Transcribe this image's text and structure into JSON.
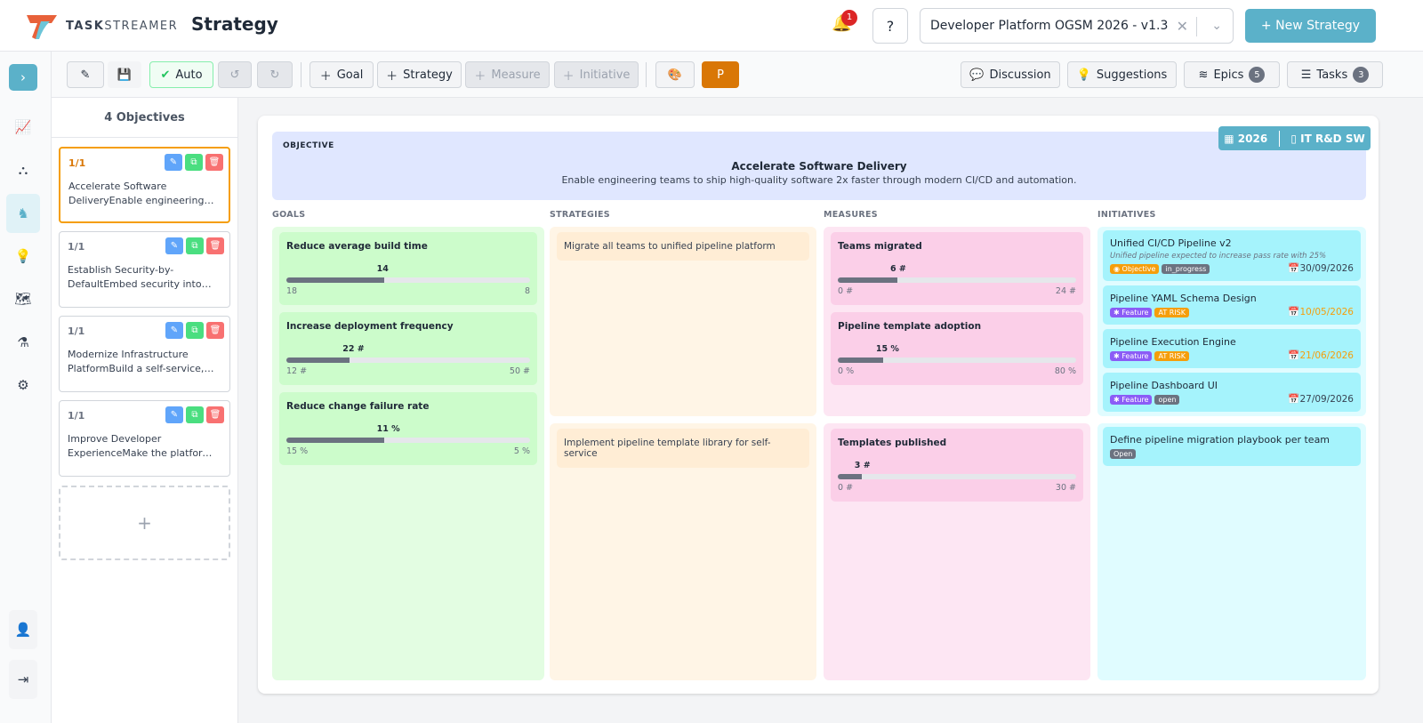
{
  "header": {
    "brand_a": "TASK",
    "brand_b": "STREAMER",
    "title": "Strategy",
    "notifications": "1",
    "strategy_select": "Developer Platform OGSM 2026 - v1.3",
    "new_strategy": "+ New Strategy"
  },
  "toolbar": {
    "auto": "Auto",
    "goal": "Goal",
    "strategy": "Strategy",
    "measure": "Measure",
    "initiative": "Initiative",
    "discussion": "Discussion",
    "suggestions": "Suggestions",
    "epics": "Epics",
    "epics_count": "5",
    "tasks": "Tasks",
    "tasks_count": "3"
  },
  "objectives_panel": {
    "heading": "4 Objectives",
    "items": [
      {
        "num": "1/1",
        "text": "Accelerate Software DeliveryEnable engineering teams to ship high-quality software 2x faster through modern CI/CD and automation."
      },
      {
        "num": "1/1",
        "text": "Establish Security-by-DefaultEmbed security into every stage"
      },
      {
        "num": "1/1",
        "text": "Modernize Infrastructure PlatformBuild a self-service, scalable platform"
      },
      {
        "num": "1/1",
        "text": "Improve Developer ExperienceMake the platform delightful to use"
      }
    ],
    "add": "+"
  },
  "objective": {
    "label": "OBJECTIVE",
    "title": "Accelerate Software Delivery",
    "description": "Enable engineering teams to ship high-quality software 2x faster through modern CI/CD and automation.",
    "year": "2026",
    "org": "IT R&D SW"
  },
  "columns": {
    "goals": "GOALS",
    "strategies": "STRATEGIES",
    "measures": "MEASURES",
    "initiatives": "INITIATIVES"
  },
  "goals": [
    {
      "title": "Reduce average build time",
      "value": "14",
      "start": "18",
      "target": "8",
      "progress": 0.4
    },
    {
      "title": "Increase deployment frequency",
      "value": "22 #",
      "start": "12 #",
      "target": "50 #",
      "progress": 0.26
    },
    {
      "title": "Reduce change failure rate",
      "value": "11 %",
      "start": "15 %",
      "target": "5 %",
      "progress": 0.4
    }
  ],
  "strategies": [
    "Migrate all teams to unified pipeline platform",
    "Implement pipeline template library for self-service"
  ],
  "measures": [
    {
      "title": "Teams migrated",
      "value": "6 #",
      "start": "0 #",
      "target": "24 #",
      "progress": 0.25
    },
    {
      "title": "Pipeline template adoption",
      "value": "15 %",
      "start": "0 %",
      "target": "80 %",
      "progress": 0.19
    },
    {
      "title": "Templates published",
      "value": "3 #",
      "start": "0 #",
      "target": "30 #",
      "progress": 0.1
    }
  ],
  "initiatives": [
    {
      "title": "Unified CI/CD Pipeline v2",
      "desc": "Unified pipeline expected to increase pass rate with 25%",
      "type": "Objective",
      "status": "in_progress",
      "date": "30/09/2026"
    },
    {
      "title": "Pipeline YAML Schema Design",
      "type": "Feature",
      "status": "AT RISK",
      "date": "10/05/2026"
    },
    {
      "title": "Pipeline Execution Engine",
      "type": "Feature",
      "status": "AT RISK",
      "date": "21/06/2026"
    },
    {
      "title": "Pipeline Dashboard UI",
      "type": "Feature",
      "status": "open",
      "date": "27/09/2026"
    },
    {
      "title": "Define pipeline migration playbook per team",
      "status": "Open"
    }
  ],
  "colors": {
    "accent": "#5bb1c9",
    "goal_bg": "#ccfccb",
    "strategy_bg": "#ffedd5",
    "measure_bg": "#fbcfe8",
    "initiative_bg": "#a5f3fc",
    "at_risk": "#f59e0b",
    "feature": "#8b5cf6"
  }
}
